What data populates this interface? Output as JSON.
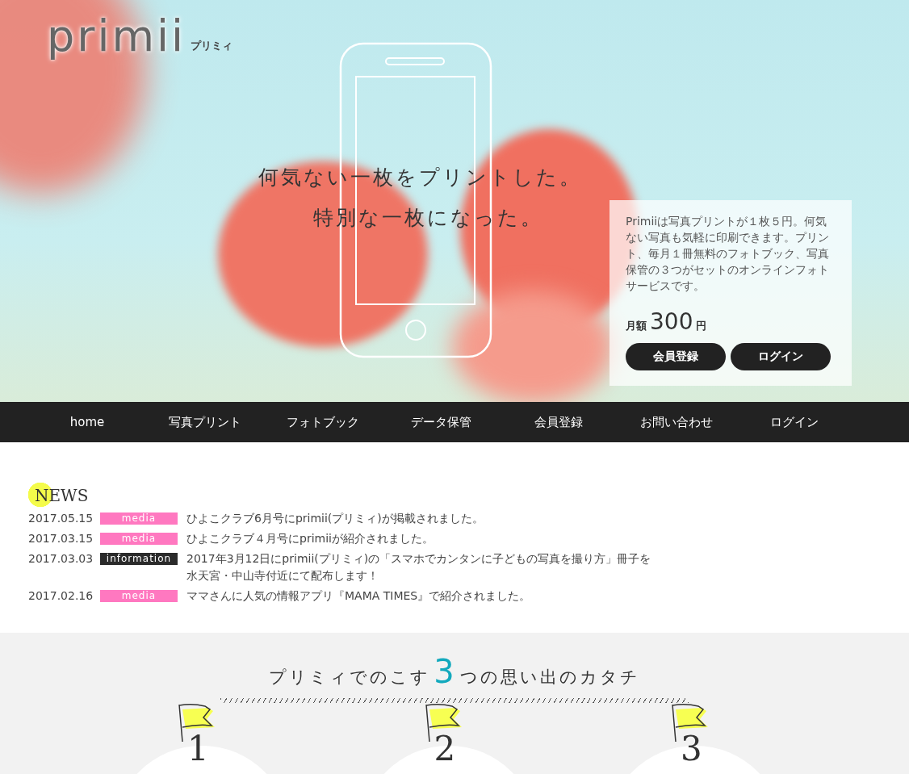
{
  "logo": {
    "wordmark": "primii",
    "kana": "プリミィ"
  },
  "hero": {
    "headline": [
      "何気ない一枚をプリントした。",
      "特別な一枚になった。"
    ],
    "card": {
      "description": "Primiiは写真プリントが１枚５円。何気ない写真も気軽に印刷できます。プリント、毎月１冊無料のフォトブック、写真保管の３つがセットのオンラインフォトサービスです。",
      "price_label": "月額",
      "price": "300",
      "price_unit": "円",
      "buttons": [
        "会員登録",
        "ログイン"
      ]
    }
  },
  "nav": {
    "items": [
      "home",
      "写真プリント",
      "フォトブック",
      "データ保管",
      "会員登録",
      "お問い合わせ",
      "ログイン"
    ]
  },
  "news": {
    "title": "NEWS",
    "items": [
      {
        "date": "2017.05.15",
        "tag": "media",
        "kind": "media",
        "lines": [
          "ひよこクラブ6月号にprimii(プリミィ)が掲載されました。"
        ]
      },
      {
        "date": "2017.03.15",
        "tag": "media",
        "kind": "media",
        "lines": [
          "ひよこクラブ４月号にprimiiが紹介されました。"
        ]
      },
      {
        "date": "2017.03.03",
        "tag": "information",
        "kind": "information",
        "lines": [
          "2017年3月12日にprimii(プリミィ)の「スマホでカンタンに子どもの写真を撮り方」冊子を",
          "水天宮・中山寺付近にて配布します！"
        ]
      },
      {
        "date": "2017.02.16",
        "tag": "media",
        "kind": "media",
        "lines": [
          "ママさんに人気の情報アプリ『MAMA TIMES』で紹介されました。"
        ]
      }
    ]
  },
  "features": {
    "title_before": "プリミィでのこす",
    "title_number": "3",
    "title_after": "つの思い出のカタチ",
    "steps": [
      "1",
      "2",
      "3"
    ]
  }
}
